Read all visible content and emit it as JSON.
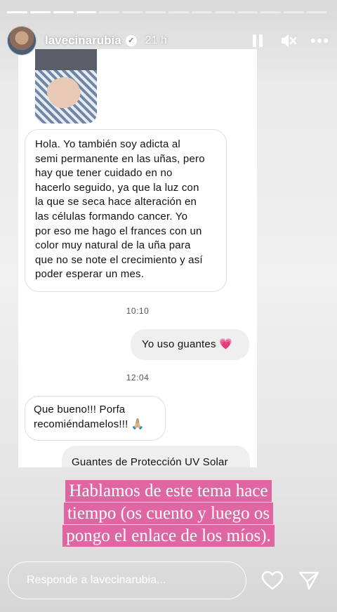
{
  "story": {
    "progress_segments_total": 14,
    "progress_segments_viewed": 4
  },
  "header": {
    "username": "lavecinarubia",
    "time_ago": "21 h",
    "verified_icon": "verified-badge-icon",
    "pause_icon": "pause-icon",
    "mute_icon": "mute-icon",
    "more_icon": "more-options-icon"
  },
  "chat": {
    "messages": [
      {
        "direction": "incoming",
        "lines": [
          "Hola. Yo también soy adicta al",
          "semi permanente en las uñas, pero",
          "hay que tener cuidado en no",
          "hacerlo seguido, ya que la luz con",
          "la que se seca hace alteración en",
          "las células formando cancer. Yo",
          "por eso me hago el frances con un",
          "color muy natural de la uña para",
          "que no se note el crecimiento y así",
          "poder esperar un mes."
        ]
      },
      {
        "timestamp": "10:10"
      },
      {
        "direction": "outgoing",
        "text": "Yo uso guantes 💗"
      },
      {
        "timestamp": "12:04"
      },
      {
        "direction": "incoming",
        "lines": [
          "Que bueno!!! Porfa",
          "recomiéndamelos!!! 🙏🏼"
        ]
      },
      {
        "direction": "outgoing",
        "text": "Guantes de Protección UV Solar"
      }
    ]
  },
  "caption": {
    "lines": [
      "Hablamos de este tema hace",
      "tiempo (os cuento y luego os",
      "pongo el enlace de los míos)."
    ],
    "highlight_color": "#e066a3"
  },
  "footer": {
    "reply_placeholder": "Responde a lavecinarubia...",
    "like_icon": "heart-icon",
    "send_icon": "send-icon"
  }
}
